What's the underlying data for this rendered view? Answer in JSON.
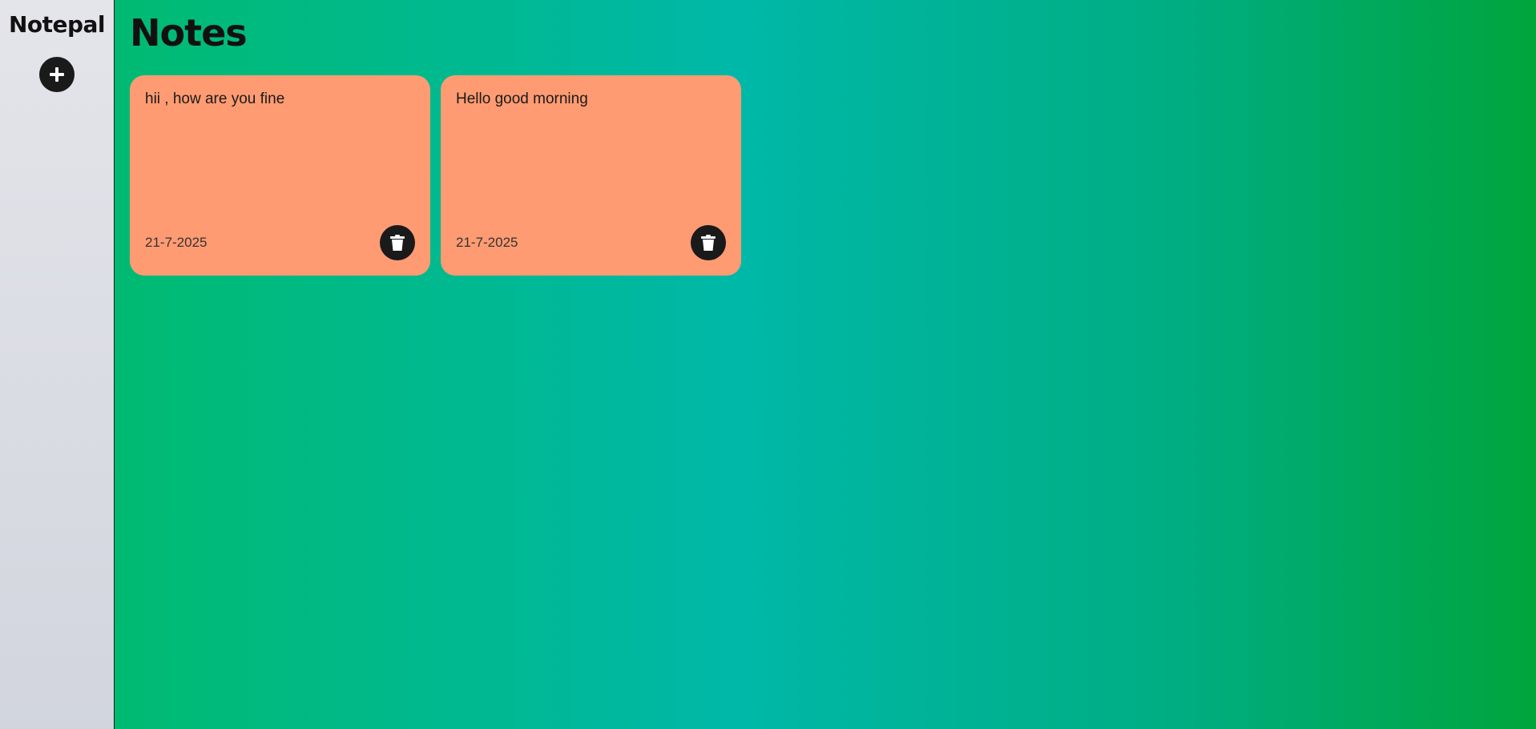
{
  "app": {
    "brand": "Notepal"
  },
  "sidebar": {
    "add_icon": "plus-icon"
  },
  "main": {
    "title": "Notes",
    "notes": [
      {
        "text": "hii , how are you fine",
        "date": "21-7-2025",
        "delete_icon": "trash-icon"
      },
      {
        "text": "Hello good morning",
        "date": "21-7-2025",
        "delete_icon": "trash-icon"
      }
    ]
  },
  "colors": {
    "sidebar_bg": "#dcdee4",
    "note_bg": "#ff9b72",
    "button_bg": "#1a1a1a",
    "gradient_start": "#00ba72",
    "gradient_mid": "#00b8a8",
    "gradient_end": "#00a53c"
  }
}
